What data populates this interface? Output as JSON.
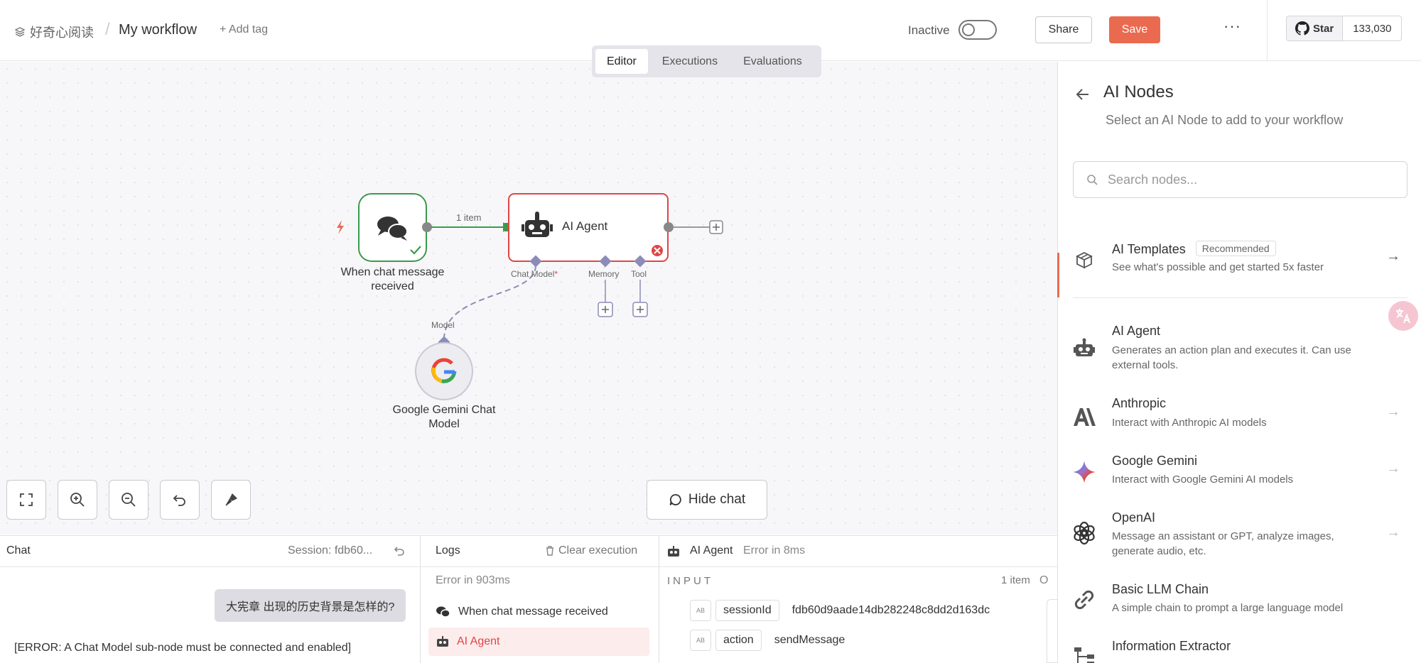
{
  "header": {
    "project": "好奇心阅读",
    "separator": "/",
    "workflow_name": "My workflow",
    "add_tag": "+ Add tag",
    "status_label": "Inactive",
    "share": "Share",
    "save": "Save",
    "more": "···",
    "github_star": "Star",
    "github_count": "133,030"
  },
  "tabs": [
    {
      "label": "Editor",
      "active": true
    },
    {
      "label": "Executions",
      "active": false
    },
    {
      "label": "Evaluations",
      "active": false
    }
  ],
  "canvas": {
    "trigger_label": "When chat message received",
    "connection_label": "1 item",
    "agent_label": "AI Agent",
    "port_chat_model": "Chat Model",
    "port_chat_model_required": "*",
    "port_memory": "Memory",
    "port_tool": "Tool",
    "model_port_label": "Model",
    "gemini_label": "Google Gemini Chat Model",
    "hide_chat": "Hide chat",
    "colors": {
      "success": "#3b9a4c",
      "error": "#e14545",
      "accent": "#ea6a4f",
      "port": "#8c8cb8"
    }
  },
  "chat_panel": {
    "title": "Chat",
    "session": "Session: fdb60...",
    "user_message": "大宪章 出现的历史背景是怎样的?",
    "error_message": "[ERROR: A Chat Model sub-node must be connected and enabled]"
  },
  "logs_panel": {
    "title": "Logs",
    "clear": "Clear execution",
    "summary": "Error in 903ms",
    "items": [
      {
        "label": "When chat message received",
        "state": "normal"
      },
      {
        "label": "AI Agent",
        "state": "error"
      }
    ]
  },
  "detail_panel": {
    "node": "AI Agent",
    "status": "Error in 8ms",
    "input_label": "INPUT",
    "item_count": "1 item",
    "fields": [
      {
        "type": "AB",
        "name": "sessionId",
        "value": "fdb60d9aade14db282248c8dd2d163dc"
      },
      {
        "type": "AB",
        "name": "action",
        "value": "sendMessage"
      }
    ],
    "output_stub": "O"
  },
  "sidebar": {
    "title": "AI Nodes",
    "subtitle": "Select an AI Node to add to your workflow",
    "search_placeholder": "Search nodes...",
    "templates": {
      "title": "AI Templates",
      "badge": "Recommended",
      "desc": "See what's possible and get started 5x faster"
    },
    "items": [
      {
        "title": "AI Agent",
        "desc": "Generates an action plan and executes it. Can use external tools.",
        "icon": "robot-icon"
      },
      {
        "title": "Anthropic",
        "desc": "Interact with Anthropic AI models",
        "icon": "anthropic-icon"
      },
      {
        "title": "Google Gemini",
        "desc": "Interact with Google Gemini AI models",
        "icon": "gemini-icon"
      },
      {
        "title": "OpenAI",
        "desc": "Message an assistant or GPT, analyze images, generate audio, etc.",
        "icon": "openai-icon"
      },
      {
        "title": "Basic LLM Chain",
        "desc": "A simple chain to prompt a large language model",
        "icon": "link-icon"
      },
      {
        "title": "Information Extractor",
        "desc": "",
        "icon": "extractor-icon"
      }
    ]
  }
}
